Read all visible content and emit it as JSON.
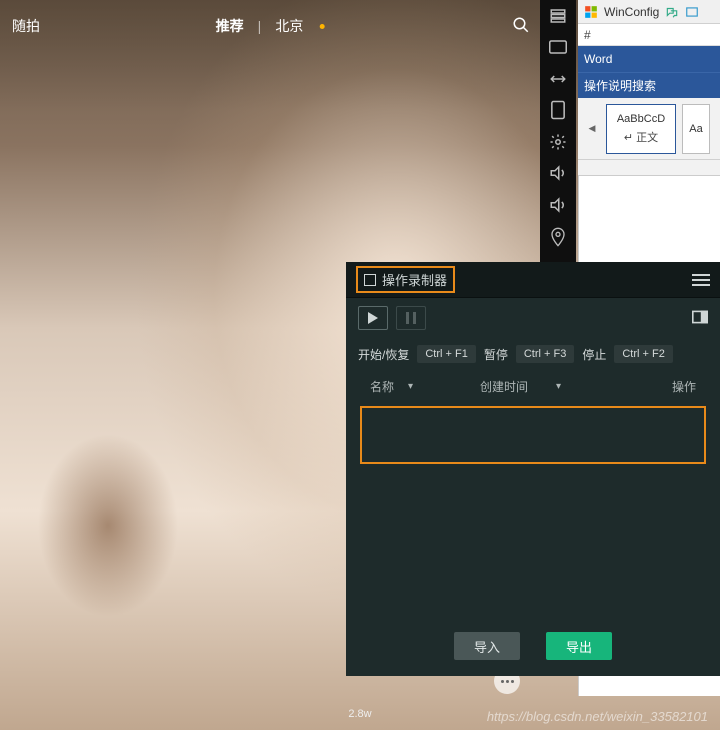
{
  "video": {
    "app_label": "随拍",
    "tab_recommend": "推荐",
    "tab_divider": "|",
    "tab_location": "北京",
    "view_count": "2.8w"
  },
  "word": {
    "winconfig": "WinConfig",
    "hash": "#",
    "app": "Word",
    "search_placeholder": "操作说明搜索",
    "style_sample": "AaBbCcD",
    "style_sample2": "Aa",
    "style_name": "正文"
  },
  "recorder": {
    "title": "操作录制器",
    "start_resume": "开始/恢复",
    "start_key": "Ctrl + F1",
    "pause": "暂停",
    "pause_key": "Ctrl + F3",
    "stop": "停止",
    "stop_key": "Ctrl + F2",
    "col_name": "名称",
    "col_time": "创建时间",
    "col_action": "操作",
    "import": "导入",
    "export": "导出"
  },
  "watermark": "https://blog.csdn.net/weixin_33582101"
}
